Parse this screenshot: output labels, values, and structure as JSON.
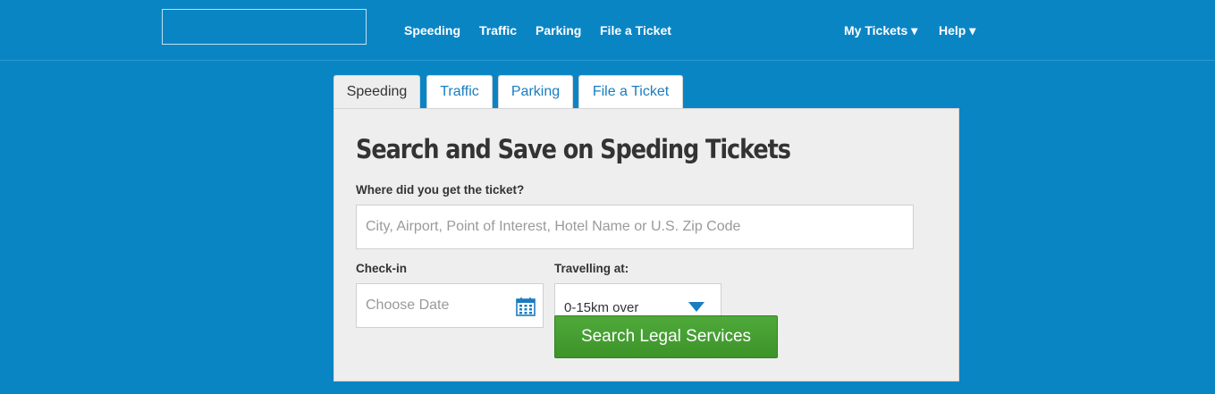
{
  "header": {
    "nav": [
      "Speeding",
      "Traffic",
      "Parking",
      "File a Ticket"
    ],
    "my_tickets": "My Tickets ▾",
    "help": "Help ▾"
  },
  "tabs": [
    {
      "label": "Speeding",
      "active": true
    },
    {
      "label": "Traffic",
      "active": false
    },
    {
      "label": "Parking",
      "active": false
    },
    {
      "label": "File a Ticket",
      "active": false
    }
  ],
  "form": {
    "title": "Search and Save on Speding Tickets",
    "location_label": "Where did you get the ticket?",
    "location_placeholder": "City, Airport, Point of Interest, Hotel Name or U.S. Zip Code",
    "checkin_label": "Check-in",
    "checkin_placeholder": "Choose Date",
    "speed_label": "Travelling at:",
    "speed_value": "0-15km over",
    "search_label": "Search Legal Services"
  },
  "colors": {
    "background": "#0a85c4",
    "link": "#1a7cc1",
    "button": "#3f9a2c"
  },
  "icons": [
    "calendar-icon",
    "dropdown-caret-icon"
  ]
}
